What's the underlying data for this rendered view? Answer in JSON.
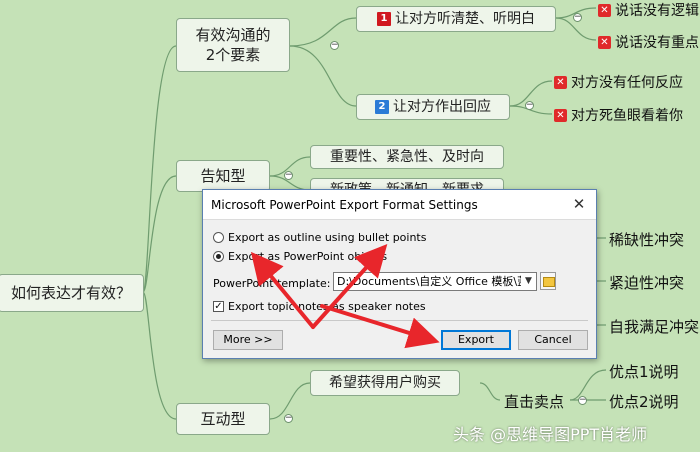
{
  "mindmap": {
    "root": "如何表达才有效？",
    "branch1": {
      "label_line1": "有效沟通的",
      "label_line2": "2个要素",
      "sub1": {
        "badge": "1",
        "label": "让对方听清楚、听明白",
        "leaves": [
          "说话没有逻辑",
          "说话没有重点"
        ]
      },
      "sub2": {
        "badge": "2",
        "label": "让对方作出回应",
        "leaves": [
          "对方没有任何反应",
          "对方死鱼眼看着你"
        ]
      }
    },
    "branch2": {
      "label": "告知型",
      "children": [
        "重要性、紧急性、及时向",
        "新政策、新通知、新要求"
      ]
    },
    "right_leaves": [
      "稀缺性冲突",
      "紧迫性冲突",
      "自我满足冲突"
    ],
    "branch3": {
      "label": "互动型",
      "children": [
        "希望获得用户购买"
      ],
      "sub": {
        "label": "直击卖点",
        "leaves": [
          "优点1说明",
          "优点2说明"
        ]
      }
    },
    "colors": {
      "background": "#c5e2b7",
      "badge_red": "#d0181f",
      "badge_blue": "#2b7bd6",
      "x_red": "#e02a2a",
      "arrow_red": "#e8262b"
    }
  },
  "dialog": {
    "title": "Microsoft PowerPoint Export Format Settings",
    "close_icon": "close-icon",
    "options": [
      {
        "label": "Export as outline using bullet points",
        "selected": false
      },
      {
        "label": "Export as PowerPoint objects",
        "selected": true
      }
    ],
    "template_label": "PowerPoint template:",
    "template_value": "D:\\Documents\\自定义 Office 模板\\蓝黑移",
    "checkbox_label": "Export topic notes as speaker notes",
    "checkbox_checked": true,
    "buttons": {
      "more": "More >>",
      "export": "Export",
      "cancel": "Cancel"
    }
  },
  "watermark": "头条 @思维导图PPT肖老师"
}
